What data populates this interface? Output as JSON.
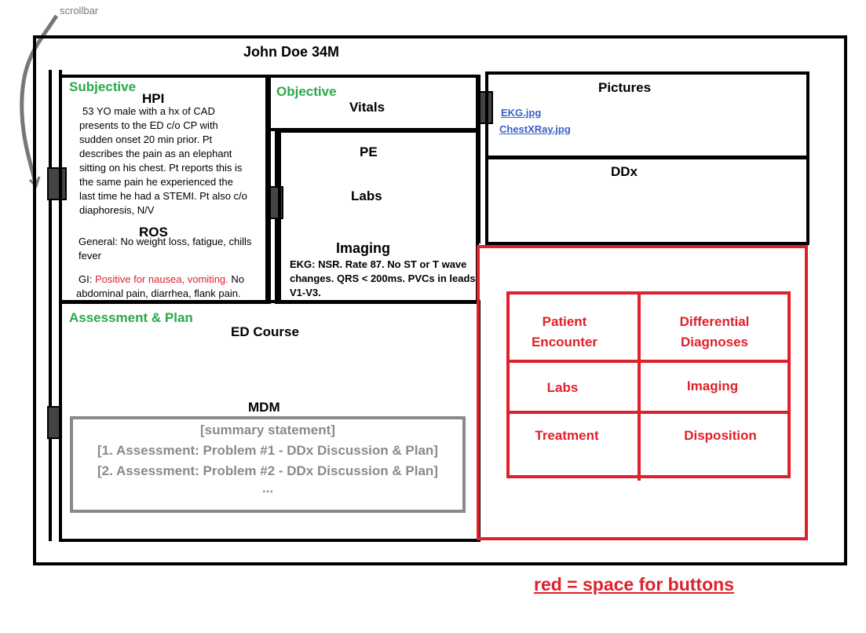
{
  "annotations": {
    "scrollbar_label": "scrollbar",
    "legend": "red = space for buttons"
  },
  "header": {
    "patient_title": "John Doe 34M"
  },
  "subjective": {
    "section_label": "Subjective",
    "hpi_title": "HPI",
    "hpi_text_1": "53 YO male with a hx of CAD",
    "hpi_text_2": "presents to the ED c/o CP with",
    "hpi_text_3": "sudden onset 20 min prior. Pt",
    "hpi_text_4": "describes the pain as an elephant",
    "hpi_text_5": "sitting on his chest. Pt reports this is",
    "hpi_text_6": "the same pain he experienced the",
    "hpi_text_7": "last time he had a STEMI. Pt also c/o",
    "hpi_text_8": "diaphoresis, N/V",
    "ros_title": "ROS",
    "ros_general_1": "General: No weight loss, fatigue, chills",
    "ros_general_2": "fever",
    "ros_gi_prefix": "GI: ",
    "ros_gi_positive": "Positive for nausea, vomiting.",
    "ros_gi_rest_1": " No",
    "ros_gi_rest_2": "abdominal pain, diarrhea, flank pain."
  },
  "objective": {
    "section_label": "Objective",
    "vitals_title": "Vitals",
    "pe_title": "PE",
    "labs_title": "Labs",
    "imaging_title": "Imaging",
    "imaging_text_1": "EKG: NSR. Rate 87. No ST or T wave",
    "imaging_text_2": "changes. QRS < 200ms. PVCs in leads",
    "imaging_text_3": "V1-V3."
  },
  "pictures": {
    "title": "Pictures",
    "files": [
      "EKG.jpg",
      "ChestXRay.jpg"
    ]
  },
  "ddx": {
    "title": "DDx"
  },
  "assessment_plan": {
    "section_label": "Assessment & Plan",
    "ed_course_title": "ED Course",
    "mdm_title": "MDM",
    "mdm_line_1": "[summary statement]",
    "mdm_line_2": "[1. Assessment: Problem #1 - DDx Discussion & Plan]",
    "mdm_line_3": "[2. Assessment: Problem #2 - DDx Discussion & Plan]",
    "mdm_line_4": "..."
  },
  "buttons": {
    "patient_encounter_1": "Patient",
    "patient_encounter_2": "Encounter",
    "differential_1": "Differential",
    "differential_2": "Diagnoses",
    "labs": "Labs",
    "imaging": "Imaging",
    "treatment": "Treatment",
    "disposition": "Disposition"
  },
  "colors": {
    "heading_green": "#2aa84a",
    "button_red": "#e0202a",
    "link_blue": "#3a5fc8",
    "mdm_gray": "#8a8a8a"
  }
}
